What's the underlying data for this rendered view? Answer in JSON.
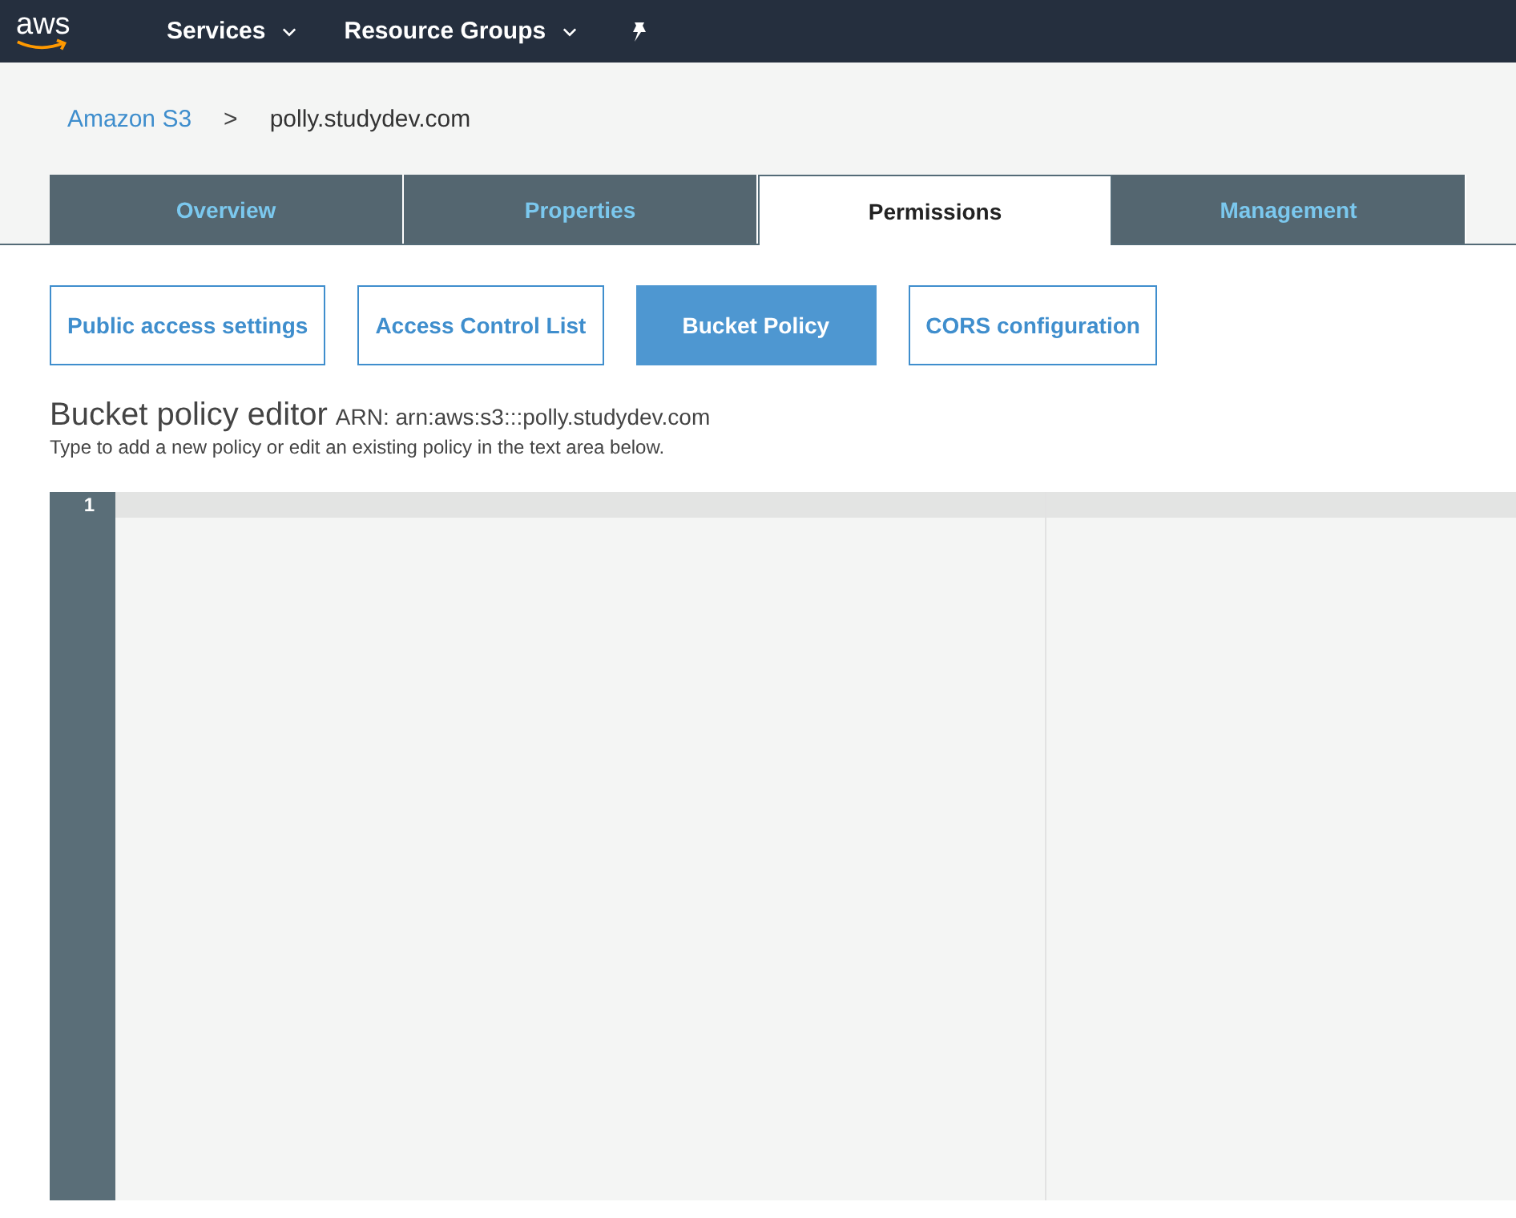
{
  "nav": {
    "logo": "aws",
    "menus": [
      {
        "label": "Services"
      },
      {
        "label": "Resource Groups"
      }
    ]
  },
  "breadcrumb": {
    "parent": "Amazon S3",
    "separator": ">",
    "current": "polly.studydev.com"
  },
  "tabs": [
    {
      "label": "Overview",
      "selected": false
    },
    {
      "label": "Properties",
      "selected": false
    },
    {
      "label": "Permissions",
      "selected": true
    },
    {
      "label": "Management",
      "selected": false
    }
  ],
  "subtabs": [
    {
      "label": "Public access settings",
      "selected": false
    },
    {
      "label": "Access Control List",
      "selected": false
    },
    {
      "label": "Bucket Policy",
      "selected": true
    },
    {
      "label": "CORS configuration",
      "selected": false
    }
  ],
  "editor_header": {
    "title": "Bucket policy editor",
    "arn": "ARN: arn:aws:s3:::polly.studydev.com",
    "hint": "Type to add a new policy or edit an existing policy in the text area below."
  },
  "editor": {
    "line_numbers": [
      "1"
    ]
  }
}
